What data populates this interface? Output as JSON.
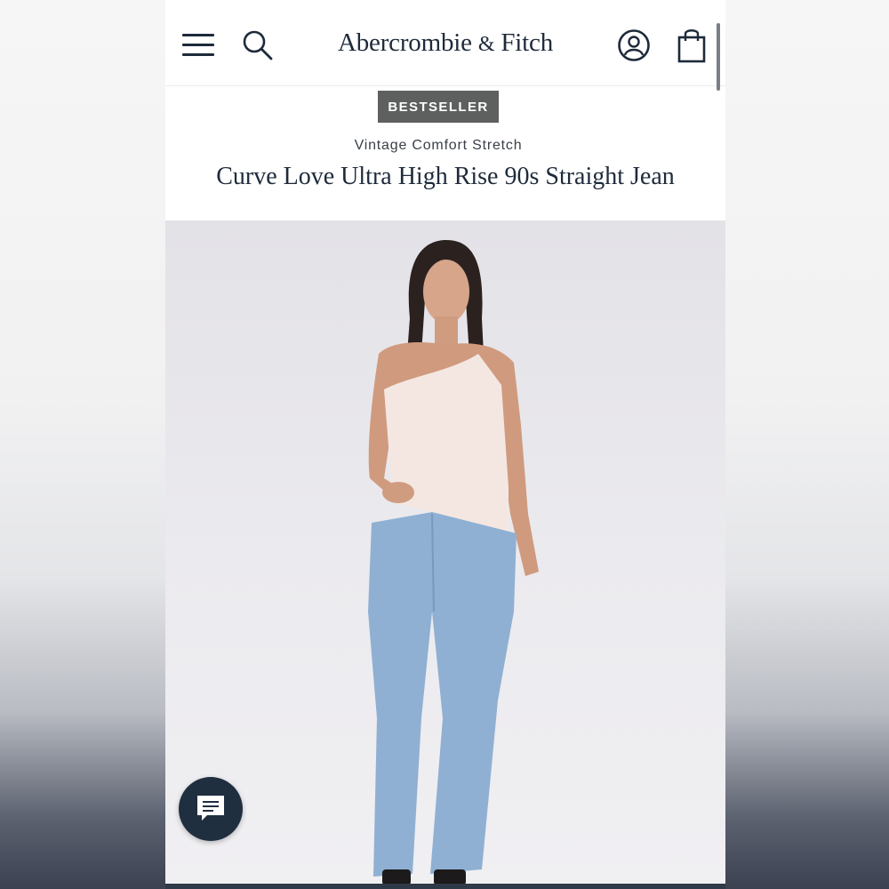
{
  "header": {
    "brand": "Abercrombie",
    "brand_amp": "&",
    "brand_end": "Fitch",
    "icons": [
      "menu-icon",
      "search-icon",
      "account-icon",
      "shopping-bag-icon"
    ]
  },
  "product": {
    "badge": "BESTSELLER",
    "collection": "Vintage Comfort Stretch",
    "title": "Curve Love Ultra High Rise 90s Straight Jean"
  },
  "chat": {
    "icon": "chat-icon"
  },
  "colors": {
    "navy": "#1e2b3b",
    "badge_bg": "#5e5f5f",
    "chat_bg": "#1f2f40",
    "denim": "#8fb0d3"
  }
}
